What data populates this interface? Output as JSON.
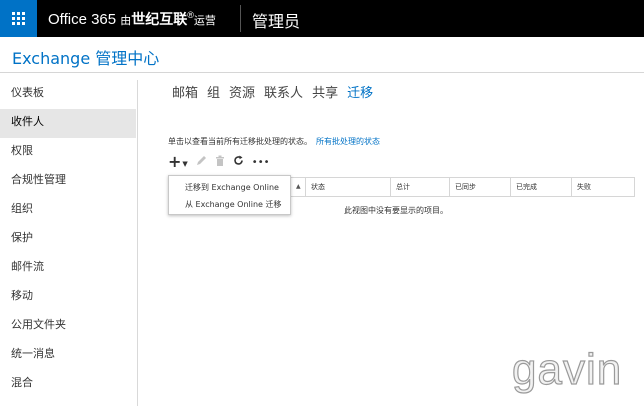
{
  "header": {
    "product": "Office 365",
    "operator_prefix": "由",
    "operator_brand": "世纪互联",
    "operator_suffix": "运营",
    "role": "管理员"
  },
  "page_title": "Exchange 管理中心",
  "sidebar": {
    "items": [
      {
        "label": "仪表板"
      },
      {
        "label": "收件人"
      },
      {
        "label": "权限"
      },
      {
        "label": "合规性管理"
      },
      {
        "label": "组织"
      },
      {
        "label": "保护"
      },
      {
        "label": "邮件流"
      },
      {
        "label": "移动"
      },
      {
        "label": "公用文件夹"
      },
      {
        "label": "统一消息"
      },
      {
        "label": "混合"
      }
    ],
    "active_index": 1
  },
  "tabs": [
    {
      "label": "邮箱"
    },
    {
      "label": "组"
    },
    {
      "label": "资源"
    },
    {
      "label": "联系人"
    },
    {
      "label": "共享"
    },
    {
      "label": "迁移"
    }
  ],
  "active_tab_index": 5,
  "instruction": {
    "text": "单击以查看当前所有迁移批处理的状态。",
    "link": "所有批处理的状态"
  },
  "toolbar": {
    "add": "+",
    "more": "•••"
  },
  "dropdown": {
    "items": [
      {
        "label": "迁移到 Exchange Online"
      },
      {
        "label": "从 Exchange Online 迁移"
      }
    ]
  },
  "table": {
    "columns": [
      {
        "label": "状态"
      },
      {
        "label": "总计"
      },
      {
        "label": "已同步"
      },
      {
        "label": "已完成"
      },
      {
        "label": "失败"
      }
    ],
    "empty_message": "此视图中没有要显示的项目。"
  },
  "watermark": "gavin",
  "colors": {
    "accent": "#0072c6",
    "topbar": "#000000"
  }
}
